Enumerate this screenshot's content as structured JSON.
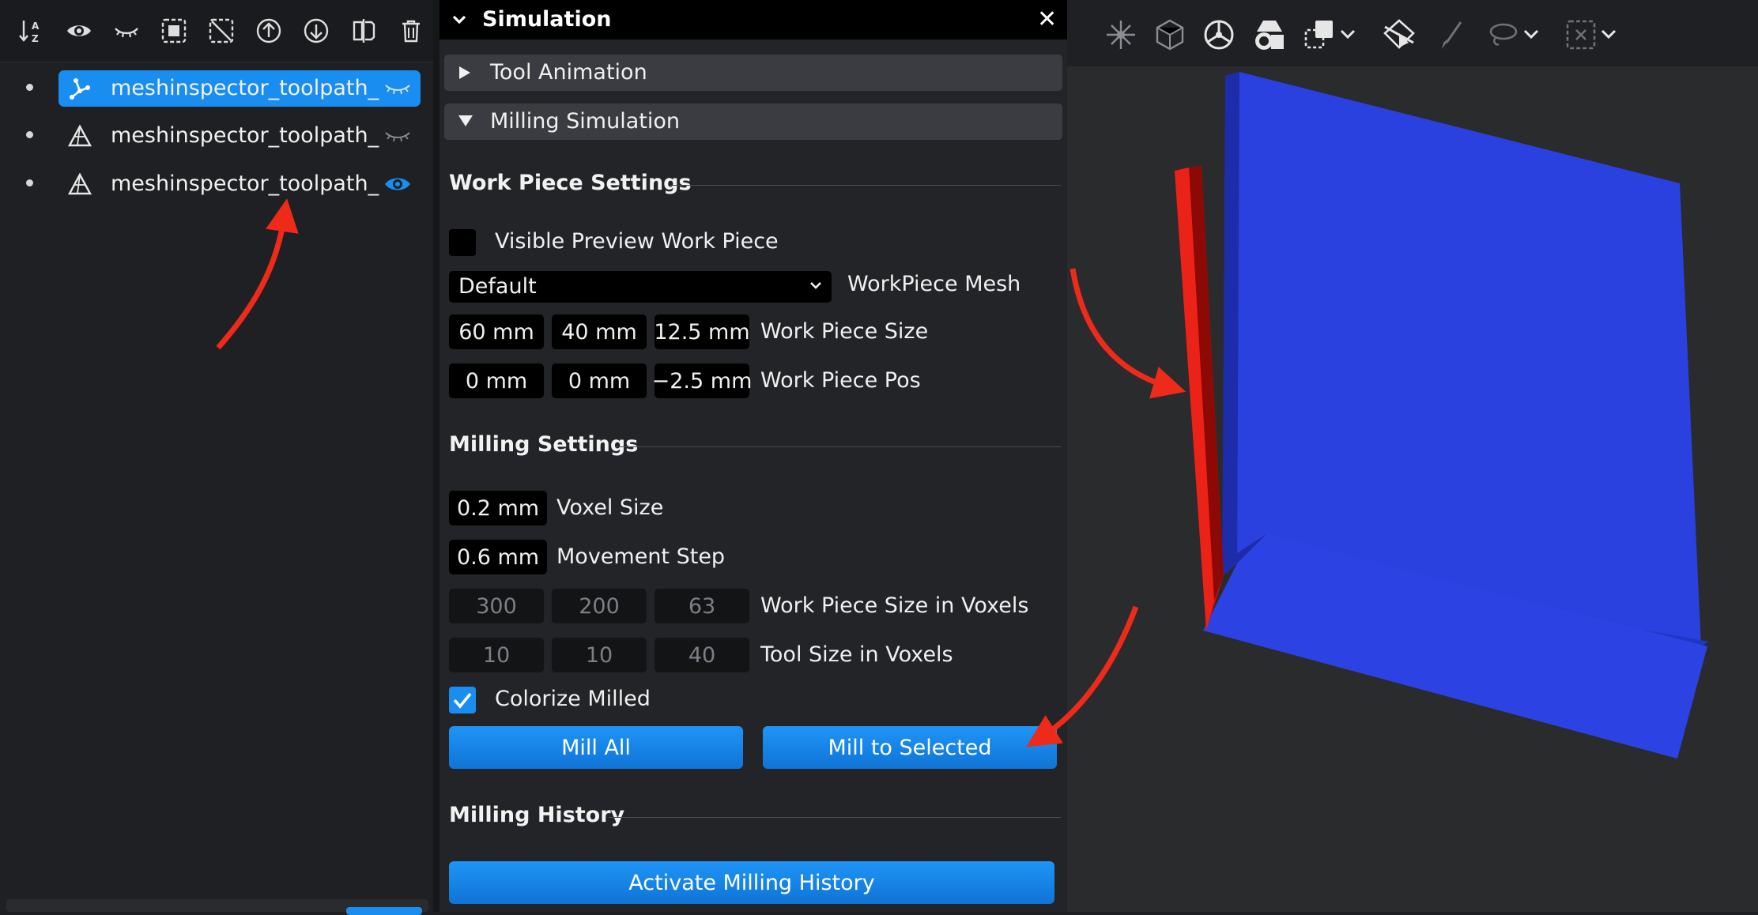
{
  "scene_tree": {
    "toolbar_icons": [
      "sort-az-icon",
      "eye-icon",
      "eye-closed-icon",
      "select-all-icon",
      "deselect-icon",
      "move-up-icon",
      "move-down-icon",
      "mirror-icon",
      "trash-icon"
    ],
    "items": [
      {
        "label": "meshinspector_toolpath_de",
        "icon": "toolpath-icon",
        "visible": false,
        "selected": true
      },
      {
        "label": "meshinspector_toolpath_de",
        "icon": "mesh-icon",
        "visible": false,
        "selected": false
      },
      {
        "label": "meshinspector_toolpath_de",
        "icon": "mesh-icon",
        "visible": true,
        "selected": false
      }
    ]
  },
  "simulation": {
    "title": "Simulation",
    "close_glyph": "✕",
    "sections": {
      "tool_animation": "Tool Animation",
      "milling_simulation": "Milling Simulation"
    },
    "work_piece": {
      "title": "Work Piece Settings",
      "visible_preview_label": "Visible Preview Work Piece",
      "visible_preview_checked": false,
      "mesh_selected": "Default",
      "mesh_label": "WorkPiece Mesh",
      "size": [
        "60 mm",
        "40 mm",
        "12.5 mm"
      ],
      "size_label": "Work Piece Size",
      "pos": [
        "0 mm",
        "0 mm",
        "−2.5 mm"
      ],
      "pos_label": "Work Piece Pos"
    },
    "milling": {
      "title": "Milling Settings",
      "voxel_size": "0.2 mm",
      "voxel_size_label": "Voxel Size",
      "movement_step": "0.6 mm",
      "movement_step_label": "Movement Step",
      "size_in_voxels": [
        "300",
        "200",
        "63"
      ],
      "size_in_voxels_label": "Work Piece Size in Voxels",
      "tool_voxels": [
        "10",
        "10",
        "40"
      ],
      "tool_voxels_label": "Tool Size in Voxels",
      "colorize_label": "Colorize Milled",
      "colorize_checked": true,
      "mill_all": "Mill All",
      "mill_to_selected": "Mill to Selected"
    },
    "history": {
      "title": "Milling History",
      "activate": "Activate Milling History"
    }
  },
  "viewport": {
    "toolbar_icons": [
      "add-point-icon",
      "frame-icon",
      "steering-icon",
      "shapes-icon",
      "copy-icon",
      "dropdown-chevron-icon",
      "slice-icon",
      "brush-icon",
      "lasso-icon",
      "dropdown-chevron-icon",
      "box-select-icon",
      "dropdown-chevron-icon"
    ],
    "colors": {
      "workpiece": "#2a3fe0",
      "milled": "#d4100b",
      "background": "#2a2b2d"
    }
  },
  "annotation_color": "#ee2a1a"
}
